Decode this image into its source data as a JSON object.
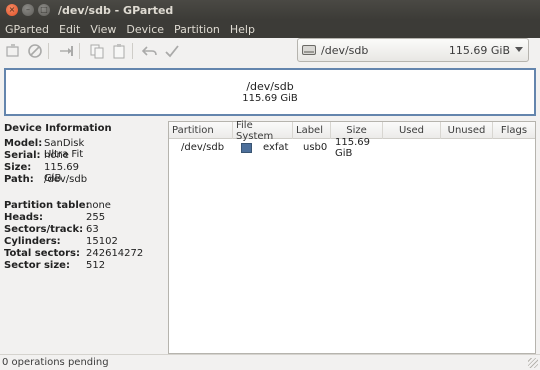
{
  "window": {
    "title": "/dev/sdb - GParted",
    "close_glyph": "×",
    "min_glyph": "–",
    "max_glyph": "□"
  },
  "menu": [
    "GParted",
    "Edit",
    "View",
    "Device",
    "Partition",
    "Help"
  ],
  "toolbar": {
    "icons": [
      "new-partition-icon",
      "delete-icon",
      "resize-move-icon",
      "copy-icon",
      "paste-icon",
      "undo-icon",
      "apply-icon"
    ],
    "device_selector": {
      "path": "/dev/sdb",
      "size": "115.69 GiB"
    }
  },
  "disk": {
    "label": "/dev/sdb",
    "size": "115.69 GiB"
  },
  "device_info": {
    "heading": "Device Information",
    "model_label": "Model:",
    "model": "SanDisk Ultra Fit",
    "serial_label": "Serial:",
    "serial": "none",
    "size_label": "Size:",
    "size": "115.69 GiB",
    "path_label": "Path:",
    "path": "/dev/sdb",
    "partition_table_label": "Partition table:",
    "partition_table": "none",
    "heads_label": "Heads:",
    "heads": "255",
    "sectors_track_label": "Sectors/track:",
    "sectors_track": "63",
    "cylinders_label": "Cylinders:",
    "cylinders": "15102",
    "total_sectors_label": "Total sectors:",
    "total_sectors": "242614272",
    "sector_size_label": "Sector size:",
    "sector_size": "512"
  },
  "table": {
    "headers": [
      "Partition",
      "File System",
      "Label",
      "Size",
      "Used",
      "Unused",
      "Flags"
    ],
    "rows": [
      {
        "partition": "/dev/sdb",
        "filesystem": "exfat",
        "fs_color": "#4d6f9a",
        "label": "usb0",
        "size": "115.69 GiB",
        "used": "",
        "unused": "",
        "flags": ""
      }
    ]
  },
  "status": {
    "text": "0 operations pending"
  },
  "colors": {
    "accent_border": "#6485ad",
    "titlebar": "#3c3b37",
    "close_button": "#e0522b"
  }
}
